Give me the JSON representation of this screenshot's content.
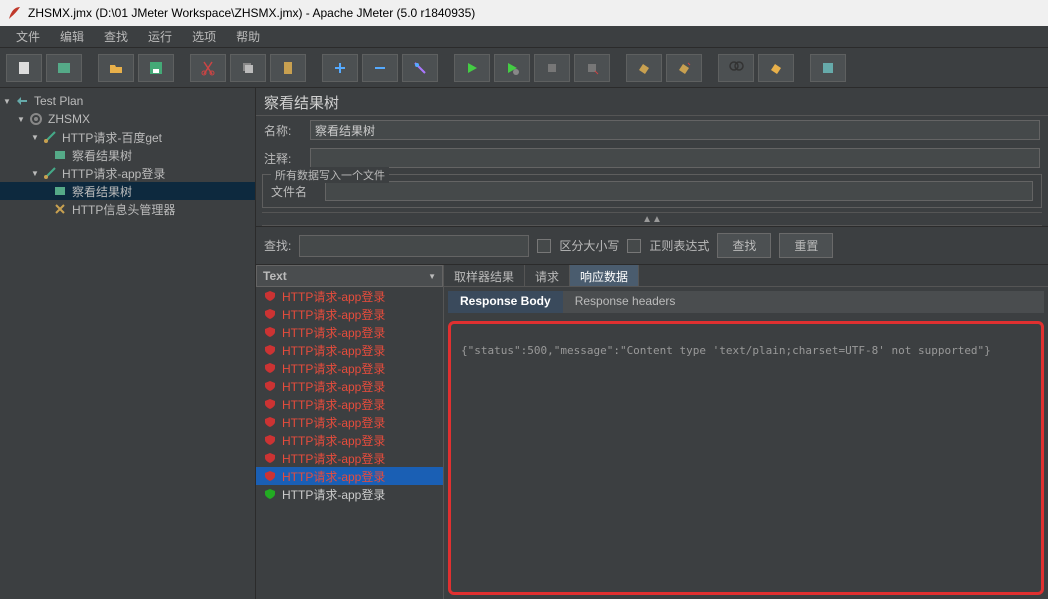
{
  "title": "ZHSMX.jmx (D:\\01 JMeter Workspace\\ZHSMX.jmx) - Apache JMeter (5.0 r1840935)",
  "menu": [
    "文件",
    "编辑",
    "查找",
    "运行",
    "选项",
    "帮助"
  ],
  "tree": {
    "root": "Test Plan",
    "plan": "ZHSMX",
    "req1": "HTTP请求-百度get",
    "req1_child": "察看结果树",
    "req2": "HTTP请求-app登录",
    "req2_child1": "察看结果树",
    "req2_child2": "HTTP信息头管理器"
  },
  "panel": {
    "title": "察看结果树",
    "name_label": "名称:",
    "name_value": "察看结果树",
    "comment_label": "注释:",
    "fieldset_label": "所有数据写入一个文件",
    "filename_label": "文件名"
  },
  "search": {
    "label": "查找:",
    "placeholder": "",
    "case_label": "区分大小写",
    "regex_label": "正则表达式",
    "find_btn": "查找",
    "reset_btn": "重置"
  },
  "sampler": {
    "dropdown": "Text",
    "items": [
      {
        "label": "HTTP请求-app登录",
        "status": "fail"
      },
      {
        "label": "HTTP请求-app登录",
        "status": "fail"
      },
      {
        "label": "HTTP请求-app登录",
        "status": "fail"
      },
      {
        "label": "HTTP请求-app登录",
        "status": "fail"
      },
      {
        "label": "HTTP请求-app登录",
        "status": "fail"
      },
      {
        "label": "HTTP请求-app登录",
        "status": "fail"
      },
      {
        "label": "HTTP请求-app登录",
        "status": "fail"
      },
      {
        "label": "HTTP请求-app登录",
        "status": "fail"
      },
      {
        "label": "HTTP请求-app登录",
        "status": "fail"
      },
      {
        "label": "HTTP请求-app登录",
        "status": "fail"
      },
      {
        "label": "HTTP请求-app登录",
        "status": "fail",
        "selected": true
      },
      {
        "label": "HTTP请求-app登录",
        "status": "ok"
      }
    ]
  },
  "tabs": {
    "sampler_result": "取样器结果",
    "request": "请求",
    "response_data": "响应数据",
    "response_body": "Response Body",
    "response_headers": "Response headers"
  },
  "response_text": "{\"status\":500,\"message\":\"Content type 'text/plain;charset=UTF-8' not supported\"}"
}
